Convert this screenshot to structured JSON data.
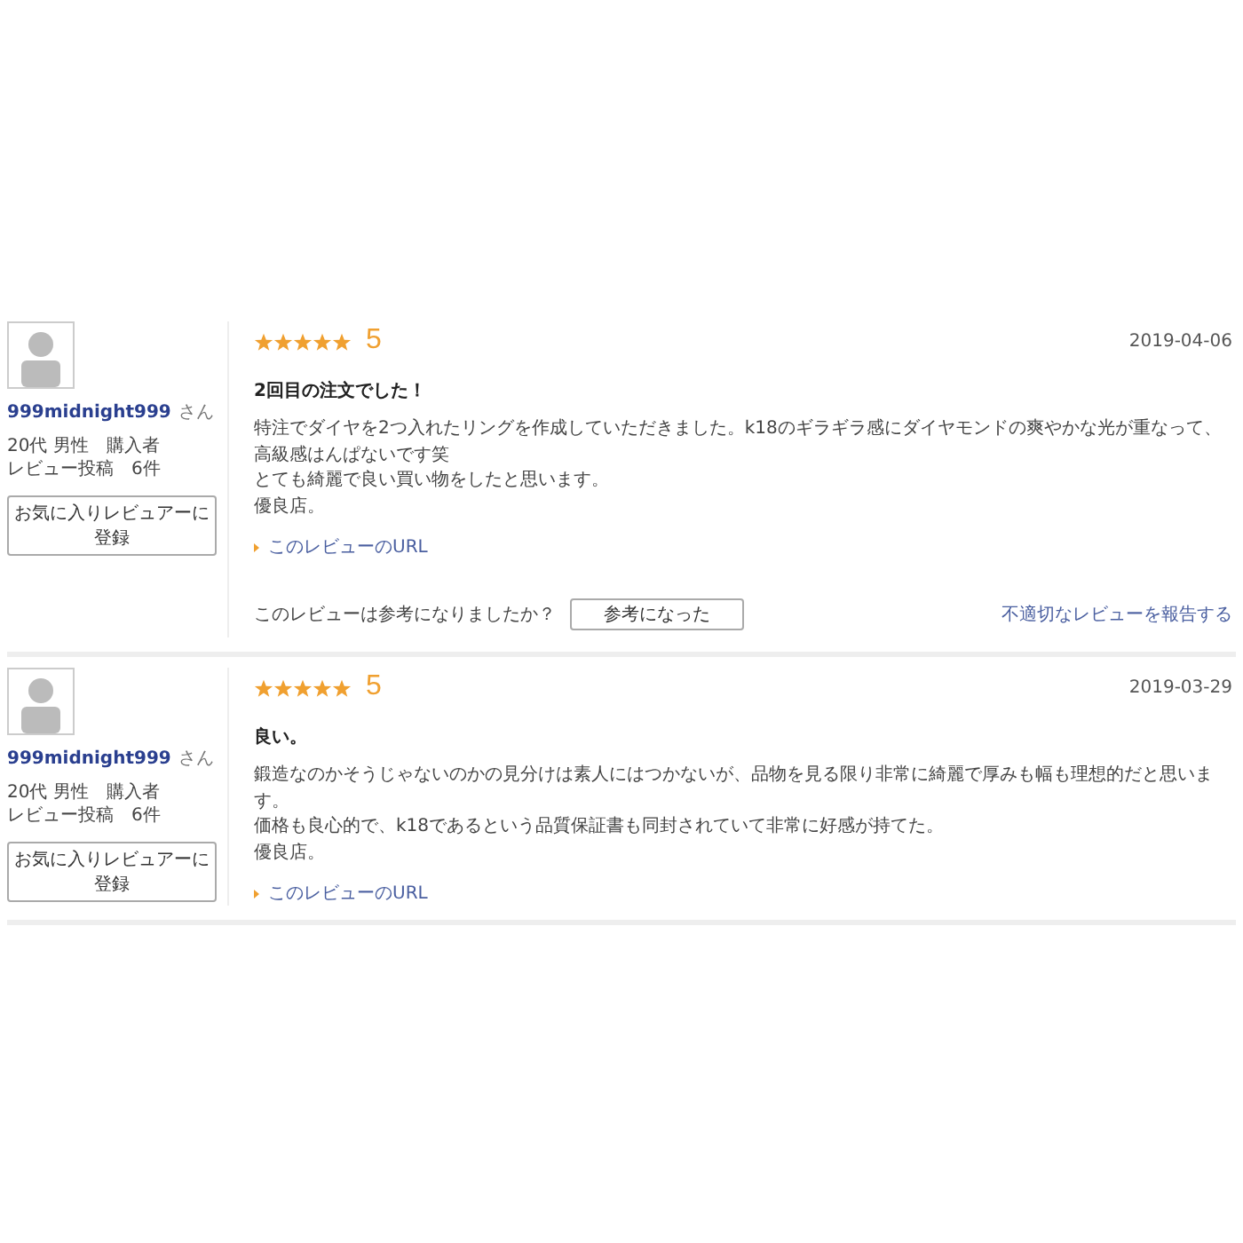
{
  "reviews": [
    {
      "reviewer": {
        "name": "999midnight999",
        "honorific": "さん",
        "profile": "20代 男性　購入者",
        "post_count": "レビュー投稿　6件",
        "favorite_button": "お気に入りレビュアーに登録"
      },
      "stars": 5,
      "rating": "5",
      "date": "2019-04-06",
      "title": "2回目の注文でした！",
      "body": [
        "特注でダイヤを2つ入れたリングを作成していただきました。k18のギラギラ感にダイヤモンドの爽やかな光が重なって、高級感はんぱないです笑",
        "とても綺麗で良い買い物をしたと思います。",
        "優良店。"
      ],
      "url_link": "このレビューのURL",
      "helpful": {
        "question": "このレビューは参考になりましたか？",
        "button": "参考になった",
        "report_link": "不適切なレビューを報告する"
      }
    },
    {
      "reviewer": {
        "name": "999midnight999",
        "honorific": "さん",
        "profile": "20代 男性　購入者",
        "post_count": "レビュー投稿　6件",
        "favorite_button": "お気に入りレビュアーに登録"
      },
      "stars": 5,
      "rating": "5",
      "date": "2019-03-29",
      "title": "良い。",
      "body": [
        "鍛造なのかそうじゃないのかの見分けは素人にはつかないが、品物を見る限り非常に綺麗で厚みも幅も理想的だと思います。",
        "価格も良心的で、k18であるという品質保証書も同封されていて非常に好感が持てた。",
        "優良店。"
      ],
      "url_link": "このレビューのURL"
    }
  ]
}
